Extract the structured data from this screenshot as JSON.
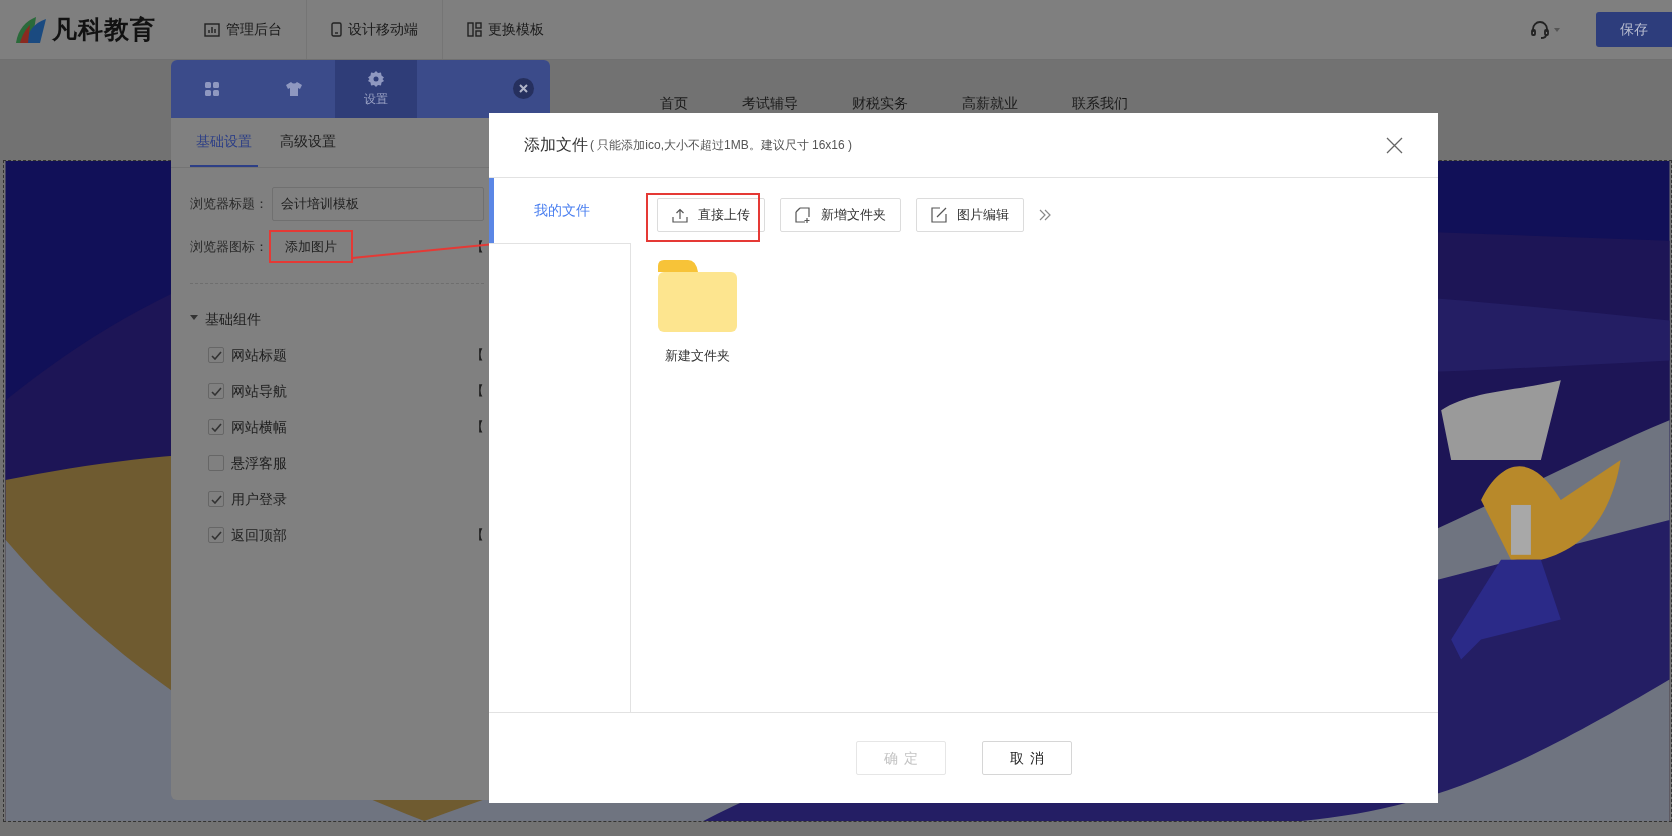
{
  "top_bar": {
    "logo": "凡科教育",
    "menu": [
      {
        "kind": "chart",
        "label": "管理后台"
      },
      {
        "kind": "phone",
        "label": "设计移动端"
      },
      {
        "kind": "template",
        "label": "更换模板"
      }
    ],
    "save_button": "保存"
  },
  "site_nav": [
    "首页",
    "考试辅导",
    "财税实务",
    "高薪就业",
    "联系我们"
  ],
  "settings_panel": {
    "icon_tabs": [
      {
        "kind": "grid",
        "selected": false
      },
      {
        "kind": "shirt",
        "selected": false
      },
      {
        "kind": "gear",
        "label": "设置",
        "selected": true
      }
    ],
    "sub_tabs": [
      {
        "label": "基础设置",
        "selected": true
      },
      {
        "label": "高级设置",
        "selected": false
      }
    ],
    "fields": [
      {
        "kind": "input",
        "label": "浏览器标题：",
        "value": "会计培训模板"
      },
      {
        "kind": "button",
        "label": "浏览器图标：",
        "value": "添加图片",
        "note": "【"
      }
    ],
    "group": {
      "title": "基础组件",
      "expanded": true,
      "items": [
        {
          "label": "网站标题",
          "checked": true,
          "note": "【"
        },
        {
          "label": "网站导航",
          "checked": true,
          "note": "【"
        },
        {
          "label": "网站横幅",
          "checked": true,
          "note": "【"
        },
        {
          "label": "悬浮客服",
          "checked": false
        },
        {
          "label": "用户登录",
          "checked": true
        },
        {
          "label": "返回顶部",
          "checked": true,
          "note": "【"
        }
      ]
    }
  },
  "dialog": {
    "title": "添加文件",
    "hint": "( 只能添加ico,大小不超过1MB。建议尺寸 16x16 )",
    "sidebar": [
      {
        "label": "我的文件",
        "selected": true
      }
    ],
    "toolbar": [
      {
        "kind": "upload",
        "label": "直接上传"
      },
      {
        "kind": "new-folder",
        "label": "新增文件夹"
      },
      {
        "kind": "edit",
        "label": "图片编辑"
      }
    ],
    "files": [
      {
        "name": "新建文件夹"
      }
    ],
    "buttons": [
      {
        "label": "确定",
        "disabled": true
      },
      {
        "label": "取消",
        "disabled": false
      }
    ]
  }
}
